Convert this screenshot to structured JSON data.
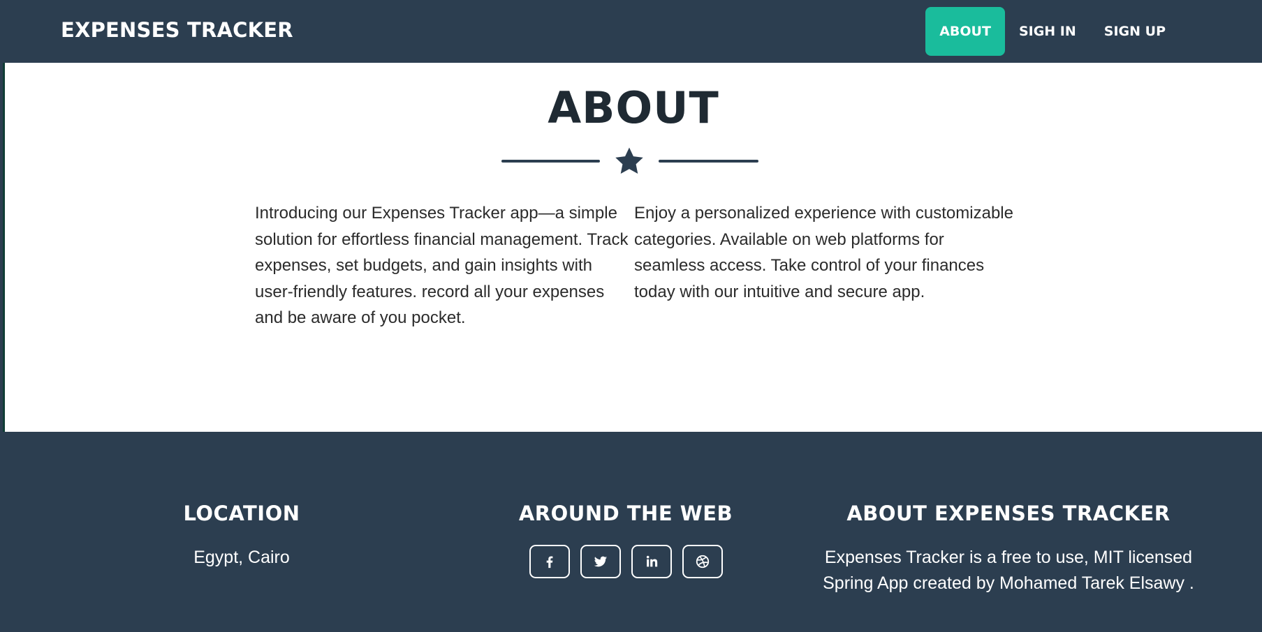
{
  "header": {
    "brand": "EXPENSES TRACKER",
    "nav": {
      "about": "ABOUT",
      "sign_in": "SIGH IN",
      "sign_up": "SIGN UP"
    },
    "active_nav": "about"
  },
  "about": {
    "title": "ABOUT",
    "divider_icon": "star-icon",
    "paragraph_left": "Introducing our Expenses Tracker app—a simple solution for effortless financial management. Track expenses, set budgets, and gain insights with user-friendly features. record all your expenses and be aware of you pocket.",
    "paragraph_right": "Enjoy a personalized experience with customizable categories. Available on web platforms for seamless access. Take control of your finances today with our intuitive and secure app."
  },
  "footer": {
    "location": {
      "heading": "LOCATION",
      "text": "Egypt, Cairo"
    },
    "around_the_web": {
      "heading": "AROUND THE WEB",
      "icons": [
        "facebook-icon",
        "twitter-icon",
        "linkedin-icon",
        "dribbble-icon"
      ]
    },
    "about_app": {
      "heading": "ABOUT EXPENSES TRACKER",
      "text": "Expenses Tracker is a free to use, MIT licensed Spring App created by Mohamed Tarek Elsawy ."
    }
  },
  "colors": {
    "primary": "#2c3e50",
    "accent": "#1abc9c",
    "text_dark": "#1f2a33",
    "white": "#ffffff"
  }
}
